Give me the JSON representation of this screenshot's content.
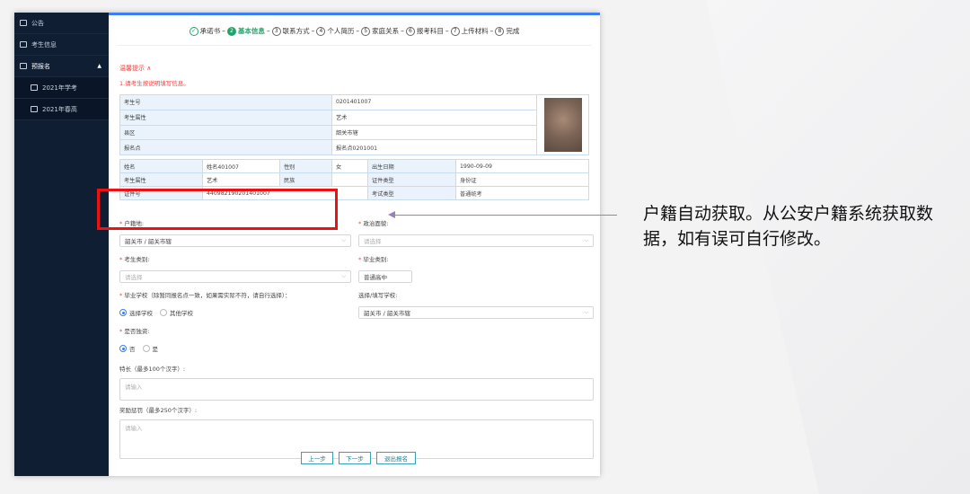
{
  "sidebar": {
    "items": [
      {
        "label": "公告",
        "icon": "notice-icon"
      },
      {
        "label": "考生信息",
        "icon": "user-info-icon"
      },
      {
        "label": "预报名",
        "icon": "registration-icon"
      }
    ],
    "sub_items": [
      {
        "label": "2021年学考"
      },
      {
        "label": "2021年春高"
      }
    ]
  },
  "steps": [
    {
      "num": "✓",
      "label": "承诺书",
      "state": "done"
    },
    {
      "num": "2",
      "label": "基本信息",
      "state": "active"
    },
    {
      "num": "3",
      "label": "联系方式",
      "state": "todo"
    },
    {
      "num": "4",
      "label": "个人简历",
      "state": "todo"
    },
    {
      "num": "5",
      "label": "家庭关系",
      "state": "todo"
    },
    {
      "num": "6",
      "label": "报考科目",
      "state": "todo"
    },
    {
      "num": "7",
      "label": "上传材料",
      "state": "todo"
    },
    {
      "num": "8",
      "label": "完成",
      "state": "todo"
    }
  ],
  "tips": {
    "title": "温馨提示 ∧",
    "line": "1.请考生按说明填写信息。"
  },
  "info1": [
    [
      "考生号",
      "0201401007"
    ],
    [
      "考生属性",
      "艺术"
    ],
    [
      "县区",
      "韶关市辖"
    ],
    [
      "报名点",
      "报名点0201001"
    ]
  ],
  "info2": [
    [
      "姓名",
      "姓名401007",
      "性别",
      "女",
      "出生日期",
      "1990-09-09"
    ],
    [
      "考生属性",
      "艺术",
      "民族",
      "",
      "证件类型",
      "身份证"
    ],
    [
      "证件号",
      "440982190201401007",
      "",
      "",
      "考试类型",
      "普通统考"
    ]
  ],
  "form": {
    "hukou_label": "户籍地:",
    "hukou_value": "韶关市 / 韶关市辖",
    "politics_label": "政治面貌:",
    "politics_placeholder": "请选择",
    "examinee_type_label": "考生类别:",
    "examinee_type_placeholder": "请选择",
    "grad_type_label": "毕业类别:",
    "grad_type_value": "普通高中",
    "school_label": "毕业学校（除暂同报名点一致，如果需实际不符，请自行选择）：",
    "school_opt1": "选择学校",
    "school_opt2": "其他学校",
    "school_fill_label": "选择/填写学校:",
    "school_fill_value": "韶关市 / 韶关市辖",
    "reside_label": "是否独资:",
    "reside_opt1": "否",
    "reside_opt2": "是",
    "specialty_label": "特长（最多100个汉字）:",
    "specialty_placeholder": "请输入",
    "award_label": "奖励惩罚（最多250个汉字）:",
    "award_placeholder": "请输入"
  },
  "buttons": {
    "prev": "上一步",
    "next": "下一步",
    "exit": "退出报名"
  },
  "annotation": "户籍自动获取。从公安户籍系统获取数据，如有误可自行修改。"
}
